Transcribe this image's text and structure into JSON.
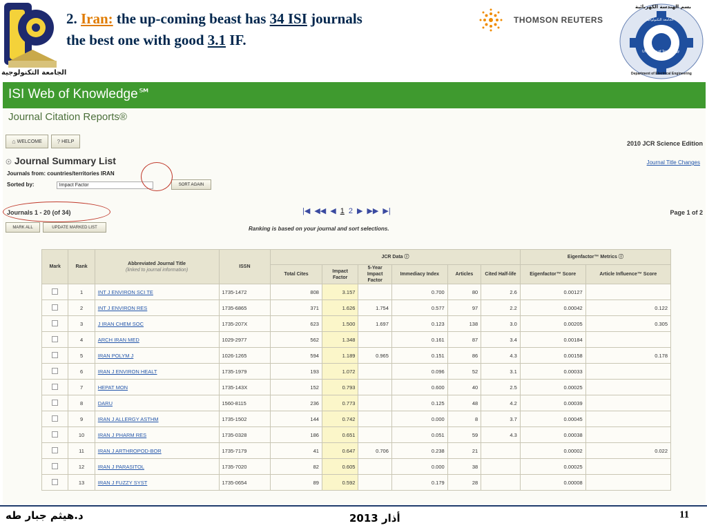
{
  "slide": {
    "title_prefix": "2.",
    "title_country": "Iran:",
    "title_mid": "the up-coming beast has",
    "title_isi": "34 ISI",
    "title_journals": "journals",
    "title_line2_pre": "the best one with good",
    "title_if_value": "3.1",
    "title_line2_post": "IF."
  },
  "logos": {
    "university_arabic": "الجامعة التكنولوجية",
    "thomson_reuters": "THOMSON REUTERS",
    "dept_arabic_top": "بسم الهندسة الكهربائية",
    "dept_arabic": "الجامعة التكنولوجية",
    "dept_ring_en": "University of Technology",
    "dept_bottom_en": "Department of Electrical Engineering"
  },
  "isi": {
    "header": "ISI Web of Knowledge℠",
    "subheader": "Journal Citation Reports®",
    "welcome_btn": "WELCOME",
    "help_btn": "HELP",
    "edition": "2010 JCR Science Edition",
    "summary_title": "Journal Summary List",
    "title_changes_link": "Journal Title Changes",
    "journals_from_label": "Journals from:",
    "journals_from_value": "countries/territories IRAN",
    "sorted_by_label": "Sorted by:",
    "sorted_by_value": "Impact Factor",
    "sort_again_btn": "SORT AGAIN",
    "journals_count": "Journals 1 - 20 (of 34)",
    "mark_all_btn": "MARK ALL",
    "update_list_btn": "UPDATE MARKED LIST",
    "pager_pages": [
      "1",
      "2"
    ],
    "page_of": "Page 1 of 2",
    "ranking_note": "Ranking is based on your journal and sort selections."
  },
  "table": {
    "headers": {
      "mark": "Mark",
      "rank": "Rank",
      "title": "Abbreviated Journal Title",
      "title_sub": "(linked to journal information)",
      "issn": "ISSN",
      "jcr_group": "JCR Data",
      "eigen_group": "Eigenfactor™ Metrics",
      "total_cites": "Total Cites",
      "impact_factor": "Impact Factor",
      "five_year": "5-Year Impact Factor",
      "immediacy": "Immediacy Index",
      "articles": "Articles",
      "cited_half_life": "Cited Half-life",
      "eigen_score": "Eigenfactor™ Score",
      "article_influence": "Article Influence™ Score"
    },
    "rows": [
      {
        "rank": "1",
        "title": "INT J ENVIRON SCI TE",
        "issn": "1735-1472",
        "cites": "808",
        "impact": "3.157",
        "five": "",
        "immediacy": "0.700",
        "articles": "80",
        "halflife": "2.6",
        "eigen": "0.00127",
        "influence": ""
      },
      {
        "rank": "2",
        "title": "INT J ENVIRON RES",
        "issn": "1735-6865",
        "cites": "371",
        "impact": "1.626",
        "five": "1.754",
        "immediacy": "0.577",
        "articles": "97",
        "halflife": "2.2",
        "eigen": "0.00042",
        "influence": "0.122"
      },
      {
        "rank": "3",
        "title": "J IRAN CHEM SOC",
        "issn": "1735-207X",
        "cites": "623",
        "impact": "1.500",
        "five": "1.697",
        "immediacy": "0.123",
        "articles": "138",
        "halflife": "3.0",
        "eigen": "0.00205",
        "influence": "0.305"
      },
      {
        "rank": "4",
        "title": "ARCH IRAN MED",
        "issn": "1029-2977",
        "cites": "562",
        "impact": "1.348",
        "five": "",
        "immediacy": "0.161",
        "articles": "87",
        "halflife": "3.4",
        "eigen": "0.00184",
        "influence": ""
      },
      {
        "rank": "5",
        "title": "IRAN POLYM J",
        "issn": "1026-1265",
        "cites": "594",
        "impact": "1.189",
        "five": "0.965",
        "immediacy": "0.151",
        "articles": "86",
        "halflife": "4.3",
        "eigen": "0.00158",
        "influence": "0.178"
      },
      {
        "rank": "6",
        "title": "IRAN J ENVIRON HEALT",
        "issn": "1735-1979",
        "cites": "193",
        "impact": "1.072",
        "five": "",
        "immediacy": "0.096",
        "articles": "52",
        "halflife": "3.1",
        "eigen": "0.00033",
        "influence": ""
      },
      {
        "rank": "7",
        "title": "HEPAT MON",
        "issn": "1735-143X",
        "cites": "152",
        "impact": "0.793",
        "five": "",
        "immediacy": "0.600",
        "articles": "40",
        "halflife": "2.5",
        "eigen": "0.00025",
        "influence": ""
      },
      {
        "rank": "8",
        "title": "DARU",
        "issn": "1560-8115",
        "cites": "236",
        "impact": "0.773",
        "five": "",
        "immediacy": "0.125",
        "articles": "48",
        "halflife": "4.2",
        "eigen": "0.00039",
        "influence": ""
      },
      {
        "rank": "9",
        "title": "IRAN J ALLERGY ASTHM",
        "issn": "1735-1502",
        "cites": "144",
        "impact": "0.742",
        "five": "",
        "immediacy": "0.000",
        "articles": "8",
        "halflife": "3.7",
        "eigen": "0.00045",
        "influence": ""
      },
      {
        "rank": "10",
        "title": "IRAN J PHARM RES",
        "issn": "1735-0328",
        "cites": "186",
        "impact": "0.651",
        "five": "",
        "immediacy": "0.051",
        "articles": "59",
        "halflife": "4.3",
        "eigen": "0.00038",
        "influence": ""
      },
      {
        "rank": "11",
        "title": "IRAN J ARTHROPOD-BOR",
        "issn": "1735-7179",
        "cites": "41",
        "impact": "0.647",
        "five": "0.706",
        "immediacy": "0.238",
        "articles": "21",
        "halflife": "",
        "eigen": "0.00002",
        "influence": "0.022"
      },
      {
        "rank": "12",
        "title": "IRAN J PARASITOL",
        "issn": "1735-7020",
        "cites": "82",
        "impact": "0.605",
        "five": "",
        "immediacy": "0.000",
        "articles": "38",
        "halflife": "",
        "eigen": "0.00025",
        "influence": ""
      },
      {
        "rank": "13",
        "title": "IRAN J FUZZY SYST",
        "issn": "1735-0654",
        "cites": "89",
        "impact": "0.592",
        "five": "",
        "immediacy": "0.179",
        "articles": "28",
        "halflife": "",
        "eigen": "0.00008",
        "influence": ""
      }
    ]
  },
  "footer": {
    "author": "د.هيثم جبار طه",
    "date": "أذار 2013",
    "page": "11"
  }
}
